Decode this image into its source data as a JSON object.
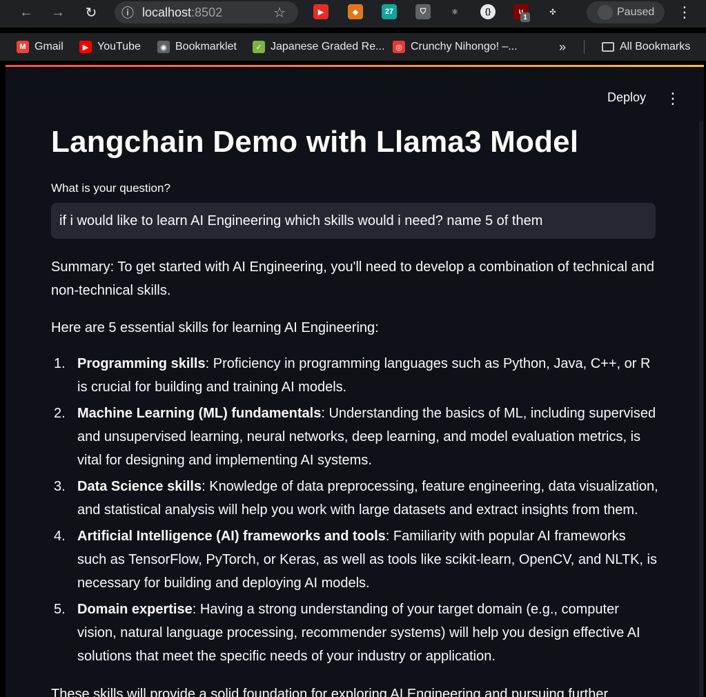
{
  "browser": {
    "nav": {
      "back": "←",
      "forward": "→",
      "reload": "↻",
      "site_info": "ⓘ"
    },
    "url": {
      "host": "localhost",
      "port": ":8502"
    },
    "profile": {
      "status": "Paused"
    },
    "extensions": [
      {
        "name": "youtube-ext-icon",
        "color": "#e52d27",
        "glyph": "▶"
      },
      {
        "name": "metamask-icon",
        "color": "#e2761b",
        "glyph": "◆"
      },
      {
        "name": "calendar-27-icon",
        "color": "#12a59c",
        "glyph": "27"
      },
      {
        "name": "shield-ext-icon",
        "color": "#5f6368",
        "glyph": "⛉"
      },
      {
        "name": "react-devtools-icon",
        "color": "#202124",
        "glyph": "⚛"
      },
      {
        "name": "json-ext-icon",
        "color": "#e8eaed",
        "glyph": "{}"
      },
      {
        "name": "ublock-icon",
        "color": "#800000",
        "glyph": "u",
        "badge": "1"
      },
      {
        "name": "extensions-puzzle-icon",
        "color": "#202124",
        "glyph": "✣"
      }
    ]
  },
  "bookmarks": [
    {
      "label": "Gmail",
      "icon": "gmail-icon",
      "color": "#ea4335",
      "glyph": "M"
    },
    {
      "label": "YouTube",
      "icon": "youtube-icon",
      "color": "#ff0000",
      "glyph": "▶"
    },
    {
      "label": "Bookmarklet",
      "icon": "globe-icon",
      "color": "#5f6368",
      "glyph": "◉"
    },
    {
      "label": "Japanese Graded Re...",
      "icon": "graded-readers-icon",
      "color": "#7cb342",
      "glyph": "✓"
    },
    {
      "label": "Crunchy Nihongo! –...",
      "icon": "crunchy-nihongo-icon",
      "color": "#e53935",
      "glyph": "◎"
    }
  ],
  "bookmarks_overflow": "»",
  "all_bookmarks": "All Bookmarks",
  "app": {
    "deploy_label": "Deploy",
    "menu_glyph": "⋮",
    "title": "Langchain Demo with Llama3 Model",
    "question_label": "What is your question?",
    "question_value": "if i would like to learn AI Engineering which skills would i need? name 5 of them",
    "summary": "Summary: To get started with AI Engineering, you'll need to develop a combination of technical and non-technical skills.",
    "intro": "Here are 5 essential skills for learning AI Engineering:",
    "skills": [
      {
        "num": "1.",
        "title": "Programming skills",
        "text": ": Proficiency in programming languages such as Python, Java, C++, or R is crucial for building and training AI models."
      },
      {
        "num": "2.",
        "title": "Machine Learning (ML) fundamentals",
        "text": ": Understanding the basics of ML, including supervised and unsupervised learning, neural networks, deep learning, and model evaluation metrics, is vital for designing and implementing AI systems."
      },
      {
        "num": "3.",
        "title": "Data Science skills",
        "text": ": Knowledge of data preprocessing, feature engineering, data visualization, and statistical analysis will help you work with large datasets and extract insights from them."
      },
      {
        "num": "4.",
        "title": "Artificial Intelligence (AI) frameworks and tools",
        "text": ": Familiarity with popular AI frameworks such as TensorFlow, PyTorch, or Keras, as well as tools like scikit-learn, OpenCV, and NLTK, is necessary for building and deploying AI models."
      },
      {
        "num": "5.",
        "title": "Domain expertise",
        "text": ": Having a strong understanding of your target domain (e.g., computer vision, natural language processing, recommender systems) will help you design effective AI solutions that meet the specific needs of your industry or application."
      }
    ],
    "closing": "These skills will provide a solid foundation for exploring AI Engineering and pursuing further"
  }
}
